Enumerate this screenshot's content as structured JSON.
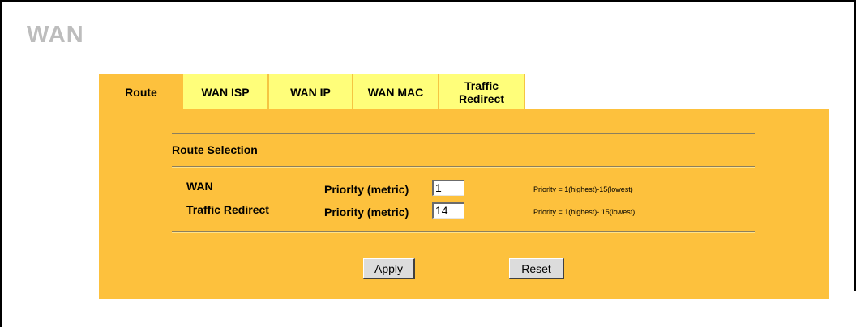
{
  "page": {
    "title": "WAN"
  },
  "tabs": [
    {
      "label": "Route",
      "active": true
    },
    {
      "label": "WAN ISP"
    },
    {
      "label": "WAN IP"
    },
    {
      "label": "WAN MAC"
    },
    {
      "label": "Traffic Redirect"
    }
  ],
  "section": {
    "title": "Route Selection"
  },
  "rows": [
    {
      "label": "WAN",
      "field_label": "Priorlty (metric)",
      "value": "1",
      "hint": "Priorlty = 1(highest)-15(lowest)"
    },
    {
      "label": "Traffic Redirect",
      "field_label": "Priority (metric)",
      "value": "14",
      "hint": "Priority = 1(highest)- 15(lowest)"
    }
  ],
  "buttons": {
    "apply": "Apply",
    "reset": "Reset"
  },
  "colors": {
    "panel": "#fdc13d",
    "tab": "#fffe7a",
    "title": "#bdbdbd"
  }
}
